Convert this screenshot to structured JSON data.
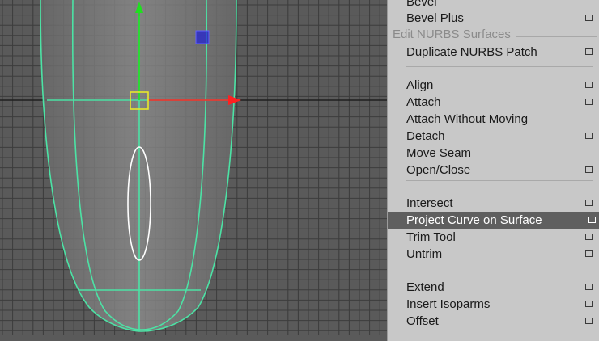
{
  "viewport": {
    "background": "#5a5a5a",
    "grid_color": "#3c3c3c",
    "surface_wire_color": "#4ce3a5",
    "curve_color": "#ffffff",
    "manipulator_colors": {
      "x_axis": "#ff2020",
      "y_axis": "#1ee01e",
      "center": "#e8e82a",
      "plane": "#2a2aff"
    }
  },
  "menu": {
    "items": [
      {
        "label": "Bevel",
        "option_box": false
      },
      {
        "label": "Bevel Plus",
        "option_box": true
      },
      {
        "label": "Edit NURBS Surfaces",
        "header": true
      },
      {
        "label": "Duplicate NURBS Patch",
        "option_box": true
      },
      {
        "label": "Align",
        "option_box": true
      },
      {
        "label": "Attach",
        "option_box": true
      },
      {
        "label": "Attach Without Moving",
        "option_box": false
      },
      {
        "label": "Detach",
        "option_box": true
      },
      {
        "label": "Move Seam",
        "option_box": false
      },
      {
        "label": "Open/Close",
        "option_box": true
      },
      {
        "label": "Intersect",
        "option_box": true
      },
      {
        "label": "Project Curve on Surface",
        "option_box": true,
        "highlighted": true
      },
      {
        "label": "Trim Tool",
        "option_box": true
      },
      {
        "label": "Untrim",
        "option_box": true
      },
      {
        "label": "Extend",
        "option_box": true
      },
      {
        "label": "Insert Isoparms",
        "option_box": true
      },
      {
        "label": "Offset",
        "option_box": true
      }
    ]
  }
}
